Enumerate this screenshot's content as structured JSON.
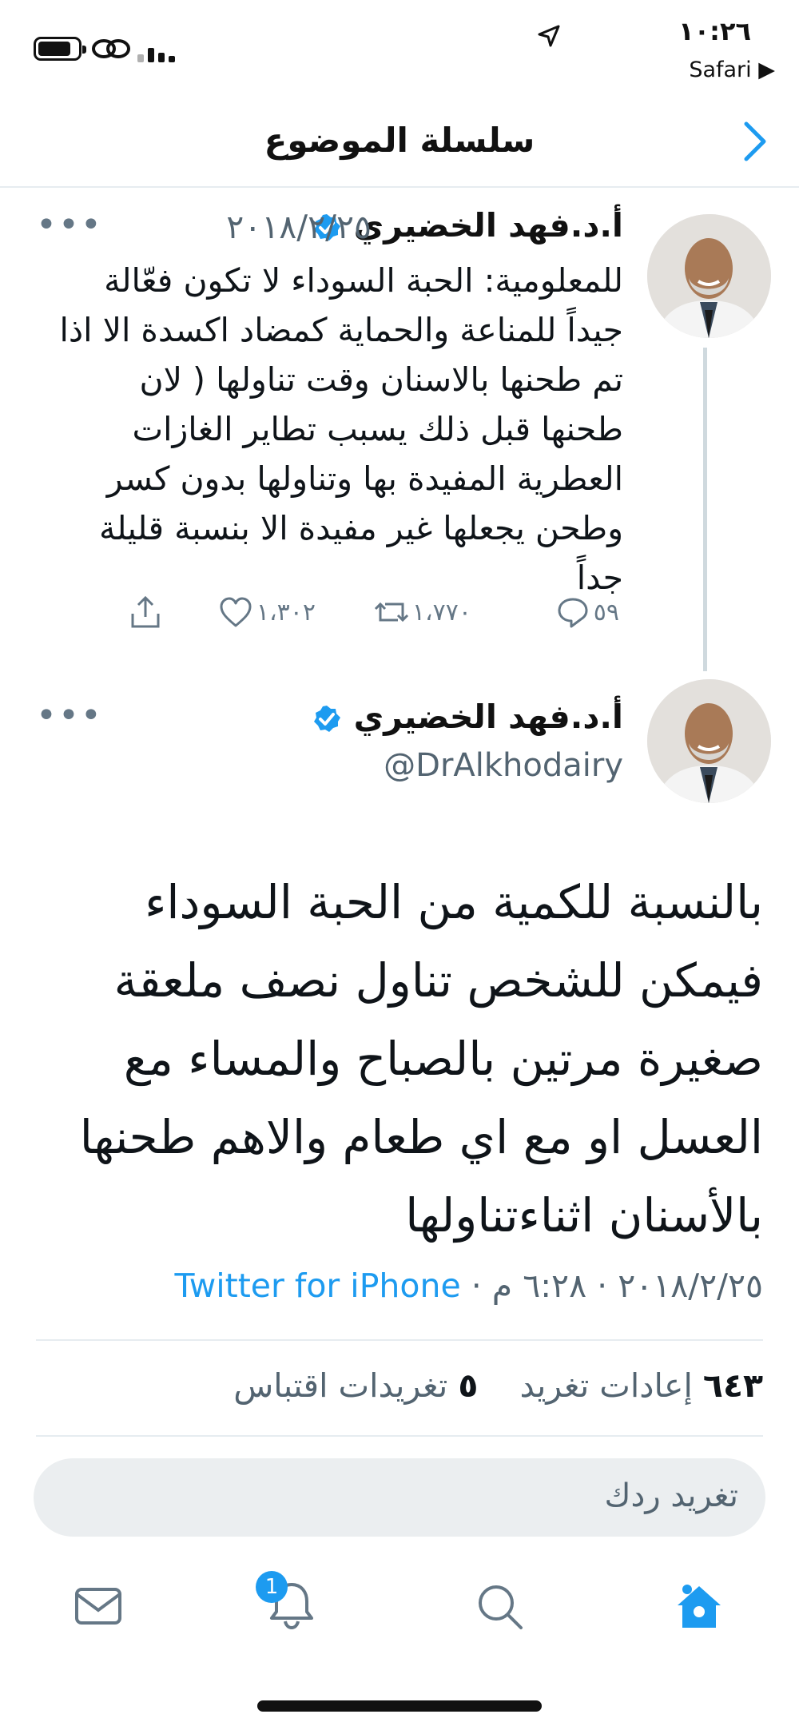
{
  "status_bar": {
    "time": "١٠:٢٦",
    "back_app": "Safari ▶"
  },
  "nav": {
    "title": "سلسلة الموضوع"
  },
  "previous_tweet": {
    "author": "أ.د.فهد الخضيري",
    "date": "٢٠١٨/٢/٢٥",
    "more": "•••",
    "text": "للمعلومية: الحبة السوداء لا تكون فعّالة جيداً للمناعة والحماية كمضاد اكسدة الا اذا تم طحنها بالاسنان وقت تناولها ( لان طحنها قبل ذلك يسبب تطاير الغازات العطرية المفيدة بها وتناولها بدون كسر وطحن يجعلها غير مفيدة الا بنسبة قليلة جداً",
    "replies": "٥٩",
    "retweets": "١،٧٧٠",
    "likes": "١،٣٠٢"
  },
  "main_tweet": {
    "author": "أ.د.فهد الخضيري",
    "handle": "@DrAlkhodairy",
    "more": "•••",
    "text": "بالنسبة للكمية من الحبة السوداء فيمكن للشخص تناول نصف ملعقة صغيرة مرتين بالصباح والمساء مع العسل او مع اي طعام والاهم طحنها بالأسنان اثناءتناولها",
    "date_time": "٢٠١٨/٢/٢٥ · ٦:٢٨ م · ",
    "source": "Twitter for iPhone",
    "retweets_count": "٦٤٣",
    "retweets_label": "إعادات تغريد",
    "quotes_count": "٥",
    "quotes_label": "تغريدات اقتباس"
  },
  "reply": {
    "placeholder": "تغريد ردك"
  },
  "tabs": {
    "notifications_badge": "1"
  },
  "colors": {
    "accent": "#1d9bf0",
    "verified": "#1d9bf0",
    "secondary_text": "#536471"
  }
}
